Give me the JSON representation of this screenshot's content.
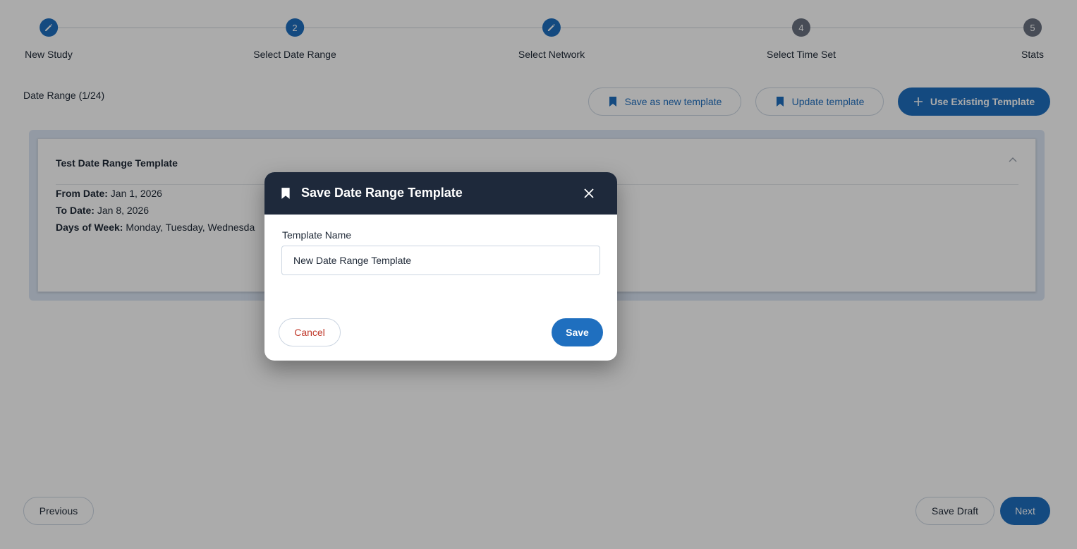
{
  "stepper": {
    "steps": [
      {
        "label": "New Study",
        "marker": "",
        "state": "done",
        "icon": "pencil-icon"
      },
      {
        "label": "Select Date Range",
        "marker": "2",
        "state": "current",
        "icon": ""
      },
      {
        "label": "Select Network",
        "marker": "",
        "state": "done",
        "icon": "pencil-icon"
      },
      {
        "label": "Select Time Set",
        "marker": "4",
        "state": "todo",
        "icon": ""
      },
      {
        "label": "Stats",
        "marker": "5",
        "state": "todo",
        "icon": ""
      }
    ]
  },
  "toolbar": {
    "section_title": "Date Range (1/24)",
    "save_new_label": "Save as new template",
    "update_label": "Update template",
    "use_existing_label": "Use Existing Template"
  },
  "card": {
    "title": "Test Date Range Template",
    "from_label": "From Date:",
    "from_value": "Jan 1, 2026",
    "to_label": "To Date:",
    "to_value": "Jan 8, 2026",
    "days_label": "Days of Week:",
    "days_value": "Monday, Tuesday, Wednesda"
  },
  "footer": {
    "previous_label": "Previous",
    "save_draft_label": "Save Draft",
    "next_label": "Next"
  },
  "modal": {
    "title": "Save Date Range Template",
    "field_label": "Template Name",
    "field_value": "New Date Range Template",
    "cancel_label": "Cancel",
    "save_label": "Save"
  },
  "colors": {
    "primary": "#1f6fbf",
    "modal_header": "#1e293b",
    "cancel_text": "#c0392b",
    "step_todo": "#6b7280"
  }
}
